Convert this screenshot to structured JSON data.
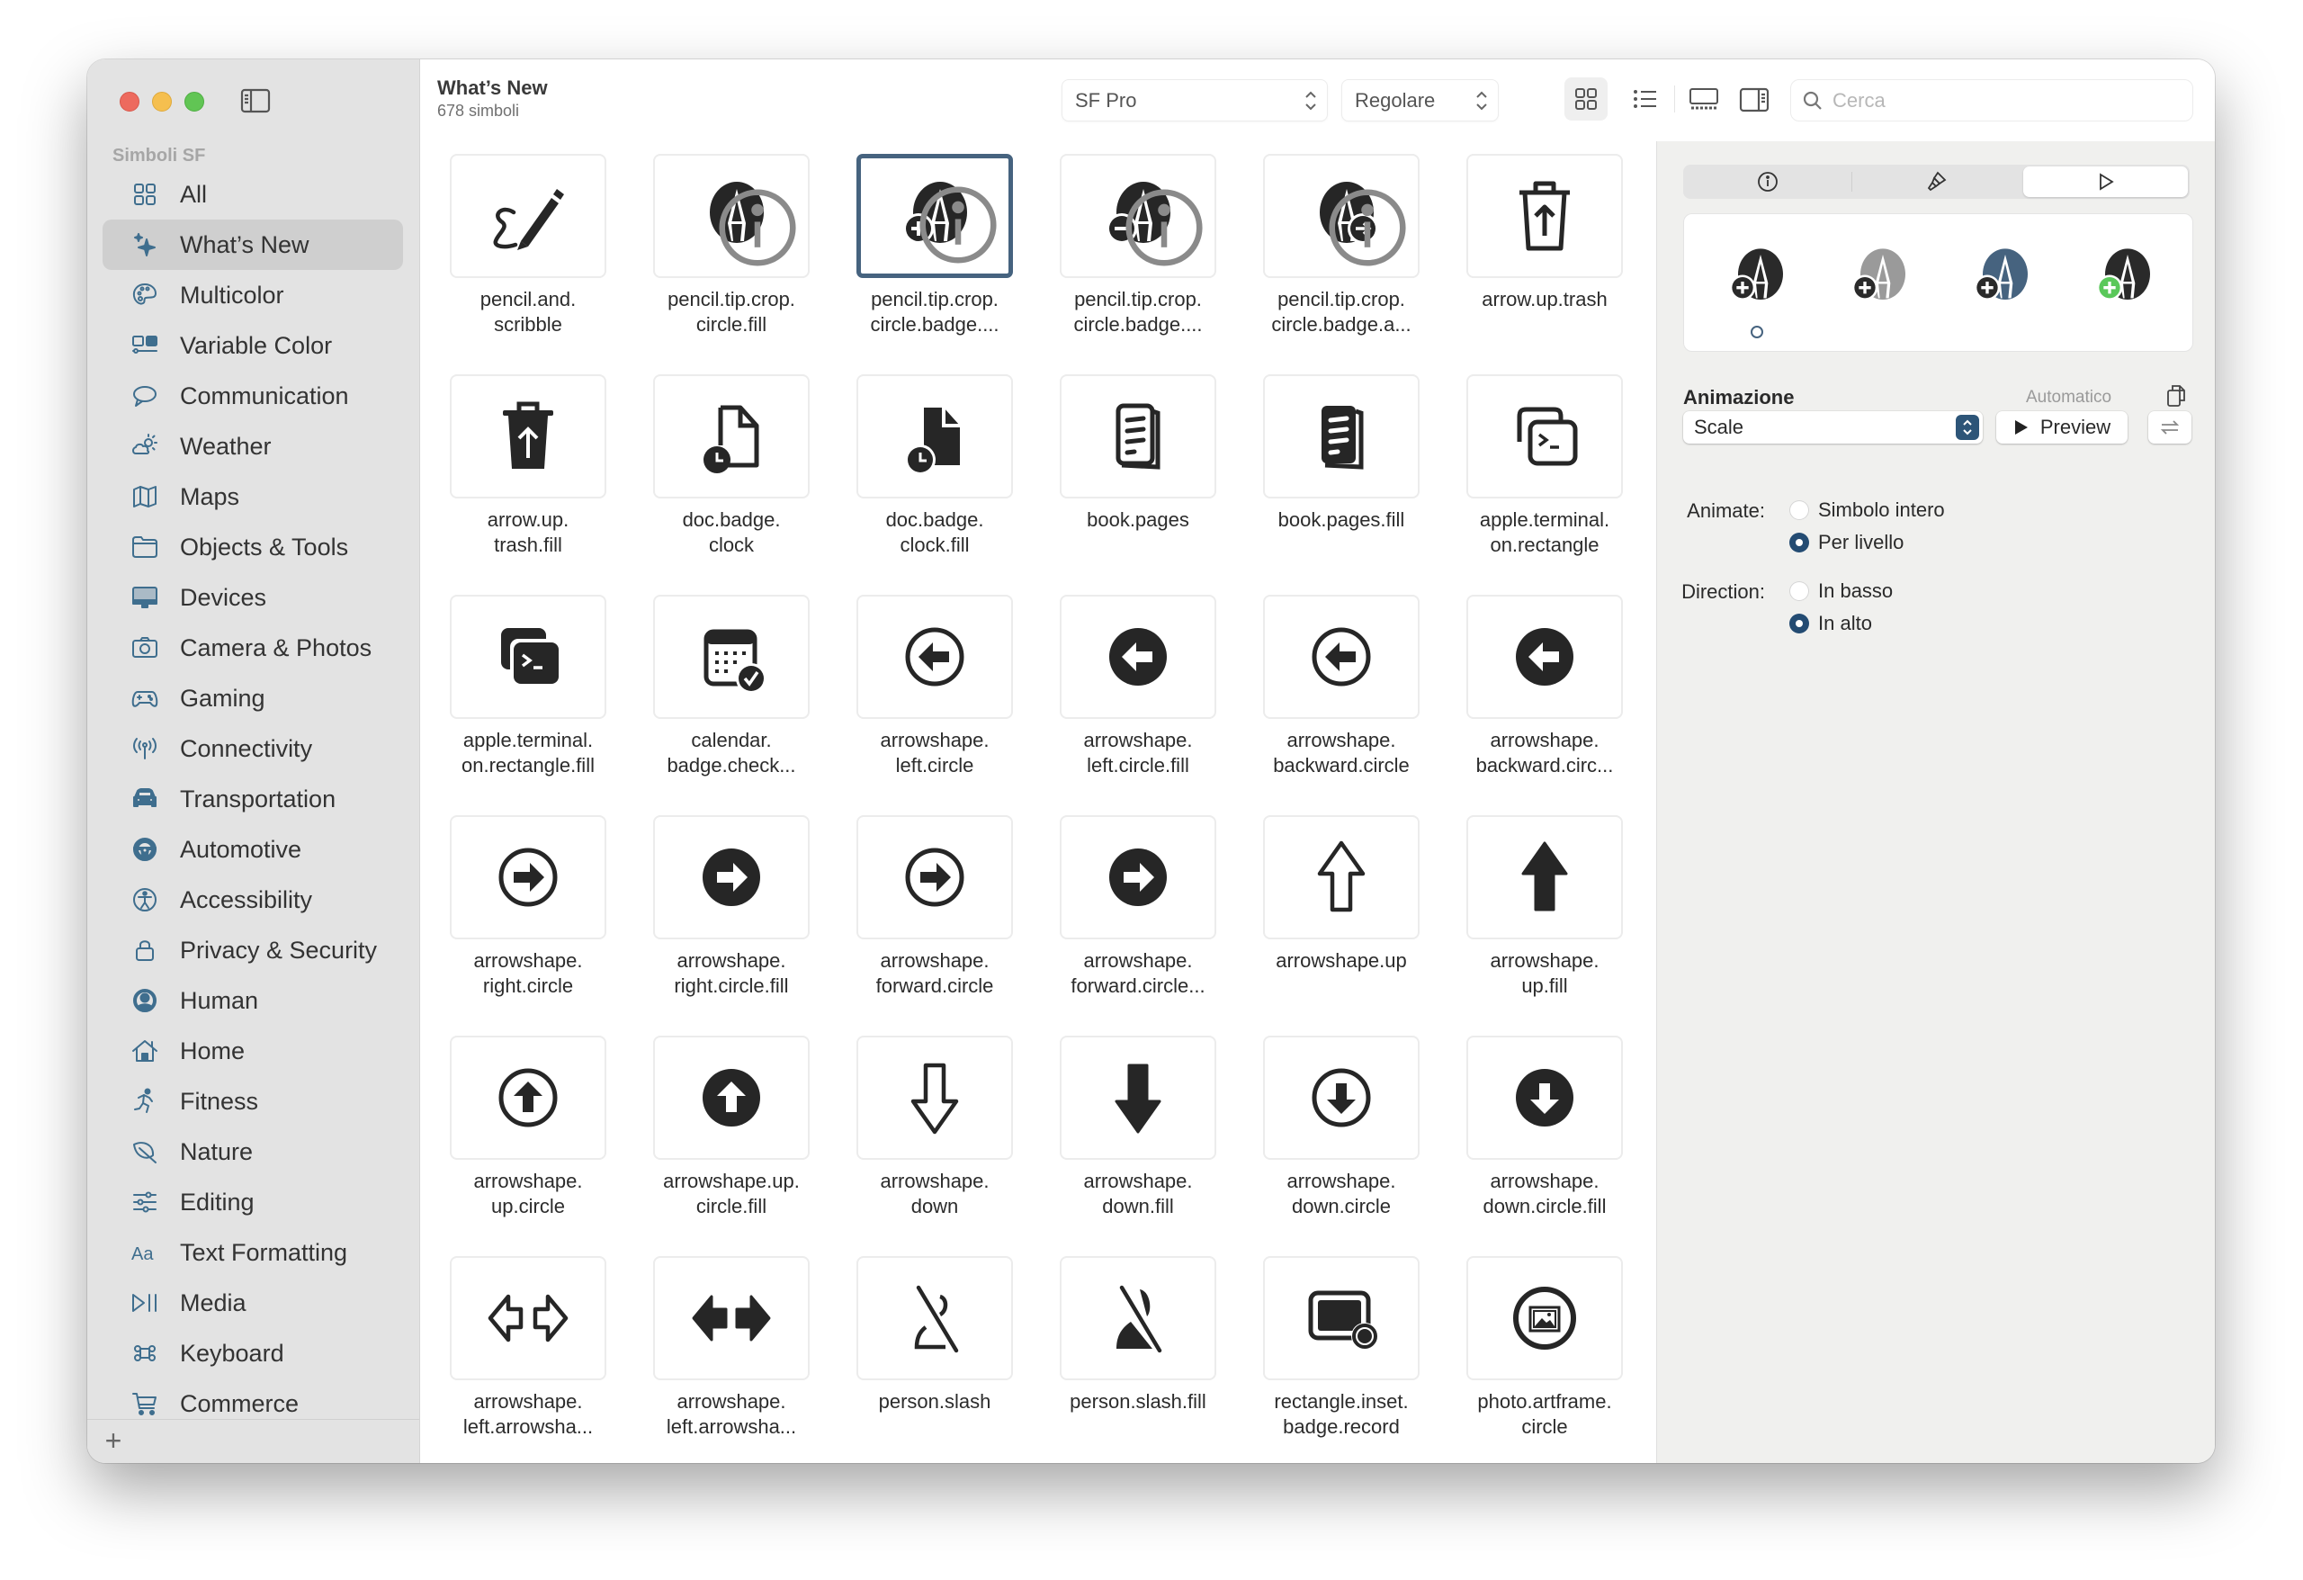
{
  "sidebar": {
    "section_title": "Simboli SF",
    "items": [
      {
        "label": "All",
        "icon": "grid-icon"
      },
      {
        "label": "What’s New",
        "icon": "sparkles-icon",
        "selected": true
      },
      {
        "label": "Multicolor",
        "icon": "palette-icon"
      },
      {
        "label": "Variable Color",
        "icon": "variable-color-icon"
      },
      {
        "label": "Communication",
        "icon": "message-bubble-icon"
      },
      {
        "label": "Weather",
        "icon": "cloud-sun-icon"
      },
      {
        "label": "Maps",
        "icon": "map-icon"
      },
      {
        "label": "Objects & Tools",
        "icon": "folder-icon"
      },
      {
        "label": "Devices",
        "icon": "desktop-icon"
      },
      {
        "label": "Camera & Photos",
        "icon": "camera-icon"
      },
      {
        "label": "Gaming",
        "icon": "gamecontroller-icon"
      },
      {
        "label": "Connectivity",
        "icon": "antenna-icon"
      },
      {
        "label": "Transportation",
        "icon": "car-icon"
      },
      {
        "label": "Automotive",
        "icon": "steering-wheel-icon"
      },
      {
        "label": "Accessibility",
        "icon": "accessibility-icon"
      },
      {
        "label": "Privacy & Security",
        "icon": "lock-icon"
      },
      {
        "label": "Human",
        "icon": "person-circle-icon"
      },
      {
        "label": "Home",
        "icon": "house-icon"
      },
      {
        "label": "Fitness",
        "icon": "figure-run-icon"
      },
      {
        "label": "Nature",
        "icon": "leaf-icon"
      },
      {
        "label": "Editing",
        "icon": "sliders-icon"
      },
      {
        "label": "Text Formatting",
        "icon": "textformat-icon"
      },
      {
        "label": "Media",
        "icon": "playpause-icon"
      },
      {
        "label": "Keyboard",
        "icon": "command-icon"
      },
      {
        "label": "Commerce",
        "icon": "cart-icon"
      }
    ],
    "add_label": "+"
  },
  "toolbar": {
    "title": "What’s New",
    "subtitle": "678 simboli",
    "font_popup": "SF Pro",
    "weight_popup": "Regolare",
    "view_modes": [
      "grid",
      "list",
      "gallery"
    ],
    "active_view": "grid",
    "search_placeholder": "Cerca",
    "search_value": ""
  },
  "grid": {
    "symbols": [
      {
        "label": "pencil.and.\nscribble",
        "glyph": "pencil-scribble",
        "info": false
      },
      {
        "label": "pencil.tip.crop.\ncircle.fill",
        "glyph": "pencil-tip-circle",
        "info": true
      },
      {
        "label": "pencil.tip.crop.\ncircle.badge....",
        "glyph": "pencil-tip-plus",
        "info": true,
        "selected": true
      },
      {
        "label": "pencil.tip.crop.\ncircle.badge....",
        "glyph": "pencil-tip-minus",
        "info": true
      },
      {
        "label": "pencil.tip.crop.\ncircle.badge.a...",
        "glyph": "pencil-tip-arrow",
        "info": true
      },
      {
        "label": "arrow.up.trash",
        "glyph": "trash-up",
        "info": false
      },
      {
        "label": "arrow.up.\ntrash.fill",
        "glyph": "trash-up-fill",
        "info": false
      },
      {
        "label": "doc.badge.\nclock",
        "glyph": "doc-clock",
        "info": false
      },
      {
        "label": "doc.badge.\nclock.fill",
        "glyph": "doc-clock-fill",
        "info": false
      },
      {
        "label": "book.pages",
        "glyph": "book-pages",
        "info": false
      },
      {
        "label": "book.pages.fill",
        "glyph": "book-pages-fill",
        "info": false
      },
      {
        "label": "apple.terminal.\non.rectangle",
        "glyph": "terminal-rect",
        "info": false
      },
      {
        "label": "apple.terminal.\non.rectangle.fill",
        "glyph": "terminal-rect-fill",
        "info": false
      },
      {
        "label": "calendar.\nbadge.check...",
        "glyph": "calendar-check",
        "info": false
      },
      {
        "label": "arrowshape.\nleft.circle",
        "glyph": "arrow-left-circle",
        "info": false
      },
      {
        "label": "arrowshape.\nleft.circle.fill",
        "glyph": "arrow-left-circle-fill",
        "info": false
      },
      {
        "label": "arrowshape.\nbackward.circle",
        "glyph": "arrow-left-circle",
        "info": false
      },
      {
        "label": "arrowshape.\nbackward.circ...",
        "glyph": "arrow-left-circle-fill",
        "info": false
      },
      {
        "label": "arrowshape.\nright.circle",
        "glyph": "arrow-right-circle",
        "info": false
      },
      {
        "label": "arrowshape.\nright.circle.fill",
        "glyph": "arrow-right-circle-fill",
        "info": false
      },
      {
        "label": "arrowshape.\nforward.circle",
        "glyph": "arrow-right-circle",
        "info": false
      },
      {
        "label": "arrowshape.\nforward.circle...",
        "glyph": "arrow-right-circle-fill",
        "info": false
      },
      {
        "label": "arrowshape.up",
        "glyph": "arrow-up-outline",
        "info": false
      },
      {
        "label": "arrowshape.\nup.fill",
        "glyph": "arrow-up-fill",
        "info": false
      },
      {
        "label": "arrowshape.\nup.circle",
        "glyph": "arrow-up-circle",
        "info": false
      },
      {
        "label": "arrowshape.up.\ncircle.fill",
        "glyph": "arrow-up-circle-fill",
        "info": false
      },
      {
        "label": "arrowshape.\ndown",
        "glyph": "arrow-down-outline",
        "info": false
      },
      {
        "label": "arrowshape.\ndown.fill",
        "glyph": "arrow-down-fill",
        "info": false
      },
      {
        "label": "arrowshape.\ndown.circle",
        "glyph": "arrow-down-circle",
        "info": false
      },
      {
        "label": "arrowshape.\ndown.circle.fill",
        "glyph": "arrow-down-circle-fill",
        "info": false
      },
      {
        "label": "arrowshape.\nleft.arrowsha...",
        "glyph": "arrows-left-right",
        "info": false
      },
      {
        "label": "arrowshape.\nleft.arrowsha...",
        "glyph": "arrows-left-right-fill",
        "info": false
      },
      {
        "label": "person.slash",
        "glyph": "person-slash",
        "info": false
      },
      {
        "label": "person.slash.fill",
        "glyph": "person-slash-fill",
        "info": false
      },
      {
        "label": "rectangle.inset.\nbadge.record",
        "glyph": "rect-record",
        "info": false
      },
      {
        "label": "photo.artframe.\ncircle",
        "glyph": "photo-artframe-circle",
        "info": false
      }
    ]
  },
  "inspector": {
    "tabs": [
      {
        "name": "info",
        "icon": "info-icon"
      },
      {
        "name": "rendering",
        "icon": "paintbrush-icon"
      },
      {
        "name": "animation",
        "icon": "play-icon",
        "active": true
      }
    ],
    "variants": [
      {
        "name": "monochrome",
        "primary": "#2a2a2a",
        "badge": "#2a2a2a"
      },
      {
        "name": "hierarchical",
        "primary": "#9a9a9a",
        "badge": "#2a2a2a"
      },
      {
        "name": "palette",
        "primary": "#46637f",
        "badge": "#2a2a2a"
      },
      {
        "name": "multicolor",
        "primary": "#2a2a2a",
        "badge": "#5ac85a"
      }
    ],
    "animation_title": "Animazione",
    "animation_mode": "Automatico",
    "effect_value": "Scale",
    "preview_label": "Preview",
    "animate_label": "Animate:",
    "animate_options": [
      {
        "label": "Simbolo intero",
        "checked": false
      },
      {
        "label": "Per livello",
        "checked": true
      }
    ],
    "direction_label": "Direction:",
    "direction_options": [
      {
        "label": "In basso",
        "checked": false
      },
      {
        "label": "In alto",
        "checked": true
      }
    ]
  },
  "colors": {
    "accent": "#46637f",
    "sidebar_icon": "#3f6e8e",
    "sidebar_bg": "#e3e3e3",
    "inspector_bg": "#f0f0ee",
    "multicolor_green": "#5ac85a"
  }
}
